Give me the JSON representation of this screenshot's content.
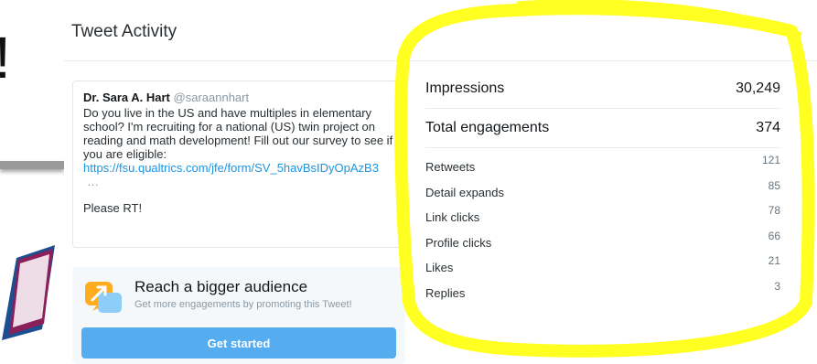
{
  "background": {
    "fragment_text": "!"
  },
  "modal": {
    "title": "Tweet Activity"
  },
  "tweet": {
    "author": "Dr. Sara A. Hart",
    "handle": "@saraannhart",
    "text": "Do you live in the US and have multiples in elementary school? I'm recruiting for a national (US) twin project on reading and math development! Fill out our survey to see if you are eligible:",
    "link": "https://fsu.qualtrics.com/jfe/form/SV_5havBsIDyOpAzB3",
    "ellipsis": "…",
    "rt": "Please RT!"
  },
  "promo": {
    "title": "Reach a bigger audience",
    "subtitle": "Get more engagements by promoting this Tweet!",
    "button_label": "Get started",
    "icon": "promote-chart-icon"
  },
  "stats": {
    "impressions_label": "Impressions",
    "impressions_value": "30,249",
    "engagements_label": "Total engagements",
    "engagements_value": "374",
    "breakdown": [
      {
        "label": "Retweets",
        "value": "121"
      },
      {
        "label": "Detail expands",
        "value": "85"
      },
      {
        "label": "Link clicks",
        "value": "78"
      },
      {
        "label": "Profile clicks",
        "value": "66"
      },
      {
        "label": "Likes",
        "value": "21"
      },
      {
        "label": "Replies",
        "value": "3"
      }
    ]
  },
  "colors": {
    "highlight": "#ffff22",
    "link": "#1b95e0",
    "button": "#55acee",
    "promo_bg": "#f5f8fa"
  }
}
